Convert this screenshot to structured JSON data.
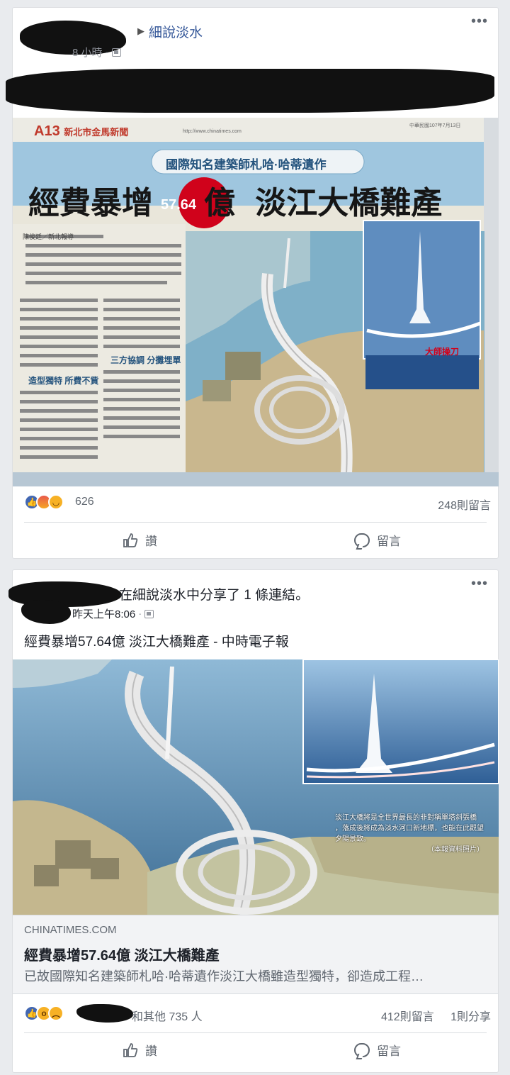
{
  "post1": {
    "group": "細說淡水",
    "time": "8 小時",
    "reaction_count": "626",
    "comments": "248則留言",
    "like_label": "讚",
    "comment_label": "留言",
    "clipping": {
      "section": "A13",
      "section_name": "新北市金馬新聞",
      "site": "http://www.chinatimes.com",
      "date": "中華民國107年7月13日",
      "kicker": "國際知名建築師札哈·哈蒂遺作",
      "headline_part1": "經費暴增",
      "headline_amount": "57.64",
      "headline_part2": "億",
      "headline_part3": "淡江大橋難產",
      "byline": "陳俊廷／新北報導",
      "subhead1": "造型獨特 所費不貲",
      "subhead2": "三方協調 分攤埋單",
      "inset_label": "大師操刀"
    }
  },
  "post2": {
    "share_text": "在細說淡水中分享了 1 條連結。",
    "time": "昨天上午8:06",
    "link_caption": "經費暴增57.64億 淡江大橋難產 - 中時電子報",
    "domain": "CHINATIMES.COM",
    "title": "經費暴增57.64億 淡江大橋難產",
    "description": "已故國際知名建築師札哈·哈蒂遺作淡江大橋雖造型獨特，卻造成工程…",
    "reactions_text": "和其他 735 人",
    "comments": "412則留言",
    "shares": "1則分享",
    "like_label": "讚",
    "comment_label": "留言",
    "photo_caption_1": "淡江大橋將是全世界最長的非對稱單塔斜張橋",
    "photo_caption_2": "，落成後將成為淡水河口新地標，也能在此觀望",
    "photo_caption_3": "夕陽景致。",
    "photo_credit": "（本報資料照片）"
  },
  "colors": {
    "link": "#365899",
    "like_blue": "#4267b2",
    "page_bg": "#e9ebee",
    "headline_red": "#d0021b"
  },
  "icons": [
    "more-options-icon",
    "globe-icon",
    "like-thumb-icon",
    "comment-bubble-icon"
  ]
}
